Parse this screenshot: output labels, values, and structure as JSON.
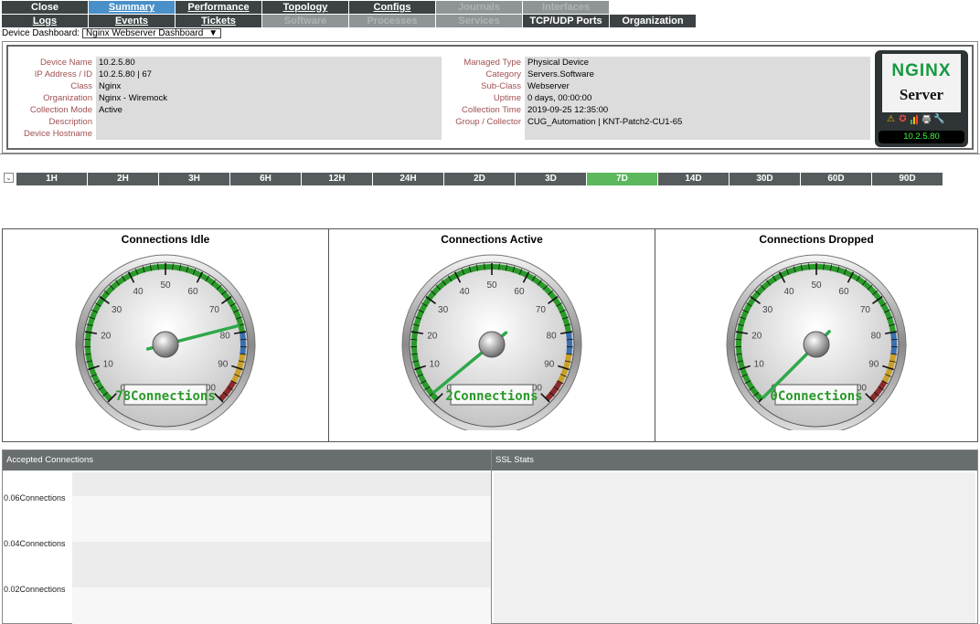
{
  "nav": {
    "row1": [
      {
        "label": "Close",
        "state": "normal"
      },
      {
        "label": "Summary",
        "state": "active"
      },
      {
        "label": "Performance",
        "state": "normal"
      },
      {
        "label": "Topology",
        "state": "normal"
      },
      {
        "label": "Configs",
        "state": "normal"
      },
      {
        "label": "Journals",
        "state": "disabled"
      },
      {
        "label": "Interfaces",
        "state": "disabled"
      }
    ],
    "row2": [
      {
        "label": "Logs",
        "state": "normal"
      },
      {
        "label": "Events",
        "state": "normal"
      },
      {
        "label": "Tickets",
        "state": "normal"
      },
      {
        "label": "Software",
        "state": "disabled"
      },
      {
        "label": "Processes",
        "state": "disabled"
      },
      {
        "label": "Services",
        "state": "disabled"
      },
      {
        "label": "TCP/UDP Ports",
        "state": "normal"
      },
      {
        "label": "Organization",
        "state": "normal"
      }
    ]
  },
  "dashboard": {
    "label": "Device Dashboard:",
    "selected": "Nginx Webserver Dashboard",
    "arrow": "▼"
  },
  "device": {
    "left": [
      {
        "label": "Device Name",
        "value": "10.2.5.80"
      },
      {
        "label": "IP Address / ID",
        "value": "10.2.5.80 | 67"
      },
      {
        "label": "Class",
        "value": "Nginx"
      },
      {
        "label": "Organization",
        "value": "Nginx - Wiremock"
      },
      {
        "label": "Collection Mode",
        "value": "Active"
      },
      {
        "label": "Description",
        "value": ""
      },
      {
        "label": "Device Hostname",
        "value": ""
      }
    ],
    "right": [
      {
        "label": "Managed Type",
        "value": "Physical Device"
      },
      {
        "label": "Category",
        "value": "Servers.Software"
      },
      {
        "label": "Sub-Class",
        "value": "Webserver"
      },
      {
        "label": "Uptime",
        "value": "0 days, 00:00:00"
      },
      {
        "label": "Collection Time",
        "value": "2019-09-25 12:35:00"
      },
      {
        "label": "Group / Collector",
        "value": "CUG_Automation | KNT-Patch2-CU1-65"
      }
    ],
    "logo": {
      "brand": "NGINX",
      "server": "Server",
      "ip": "10.2.5.80",
      "icons": [
        "warning-icon",
        "lifebuoy-icon",
        "bar-chart-icon",
        "printer-icon",
        "wrench-icon"
      ]
    }
  },
  "time_ranges": {
    "options": [
      "1H",
      "2H",
      "3H",
      "6H",
      "12H",
      "24H",
      "2D",
      "3D",
      "7D",
      "14D",
      "30D",
      "60D",
      "90D"
    ],
    "selected": "7D"
  },
  "gauges": [
    {
      "title": "Connections Idle",
      "value": 78,
      "readout": "78Connections",
      "min": 0,
      "max": 100
    },
    {
      "title": "Connections Active",
      "value": 2,
      "readout": "2Connections",
      "min": 0,
      "max": 100
    },
    {
      "title": "Connections Dropped",
      "value": 0,
      "readout": "0Connections",
      "min": 0,
      "max": 100
    }
  ],
  "gauge_ticks": [
    "0",
    "10",
    "20",
    "30",
    "40",
    "50",
    "60",
    "70",
    "80",
    "90",
    "100"
  ],
  "charts": {
    "accepted": {
      "title": "Accepted Connections",
      "y_labels": [
        "0.06Connections",
        "0.04Connections",
        "0.02Connections"
      ]
    },
    "ssl": {
      "title": "SSL Stats"
    }
  },
  "colors": {
    "tab": "#3d4345",
    "tab_active": "#4a90c8",
    "time_active": "#5cb85c",
    "needle": "#2ea84a",
    "gauge_green": "#2a9a2a"
  }
}
